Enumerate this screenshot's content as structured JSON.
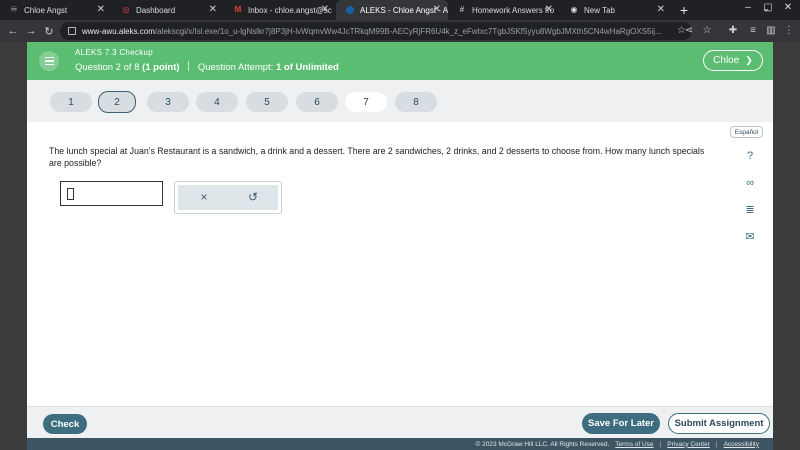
{
  "browser": {
    "tabs": [
      {
        "title": "Chloe Angst",
        "icon": "book-icon"
      },
      {
        "title": "Dashboard",
        "icon": "dashboard-icon"
      },
      {
        "title": "Inbox - chloe.angst@sc",
        "icon": "gmail-icon"
      },
      {
        "title": "ALEKS - Chloe Angst - A",
        "icon": "aleks-icon",
        "active": true
      },
      {
        "title": "Homework Answers fro",
        "icon": "hash-icon"
      },
      {
        "title": "New Tab",
        "icon": "chrome-icon"
      }
    ],
    "new_tab": "+",
    "url_host": "www-awu.aleks.com",
    "url_path": "/alekscgi/x/Isl.exe/1o_u-lgNslkr7j8P3jH-lvWqmvWw4JcTRkqM99B-AECyRjFR6U4k_z_eFwtxc7TgbJSKf5yyu8WgbJMXth5CN4wHaRgOXS5ij..."
  },
  "header": {
    "title": "ALEKS 7.3 Checkup",
    "question_prefix": "Question 2 of 8",
    "question_points": "(1 point)",
    "attempt_prefix": "Question Attempt:",
    "attempt_value": "1 of Unlimited",
    "user_name": "Chloe"
  },
  "question_nav": [
    "1",
    "2",
    "3",
    "4",
    "5",
    "6",
    "7",
    "8"
  ],
  "language_button": "Español",
  "question_text": "The lunch special at Juan's Restaurant is a sandwich, a drink and a dessert. There are 2 sandwiches, 2 drinks, and 2 desserts to choose from. How many lunch specials are possible?",
  "answer": {
    "value": ""
  },
  "tools": {
    "clear": "×",
    "undo": "↺"
  },
  "side_tools": {
    "help": "?",
    "infinity": "∞",
    "notes": "≣",
    "mail": "✉"
  },
  "footer": {
    "check": "Check",
    "save": "Save For Later",
    "submit": "Submit Assignment"
  },
  "legal": {
    "copyright": "© 2023 McGraw Hill LLC. All Rights Reserved.",
    "terms": "Terms of Use",
    "privacy": "Privacy Center",
    "accessibility": "Accessibility"
  },
  "colors": {
    "header_green": "#5bbd72",
    "accent_teal": "#3e6d80",
    "footer_bar": "#3d5563"
  }
}
